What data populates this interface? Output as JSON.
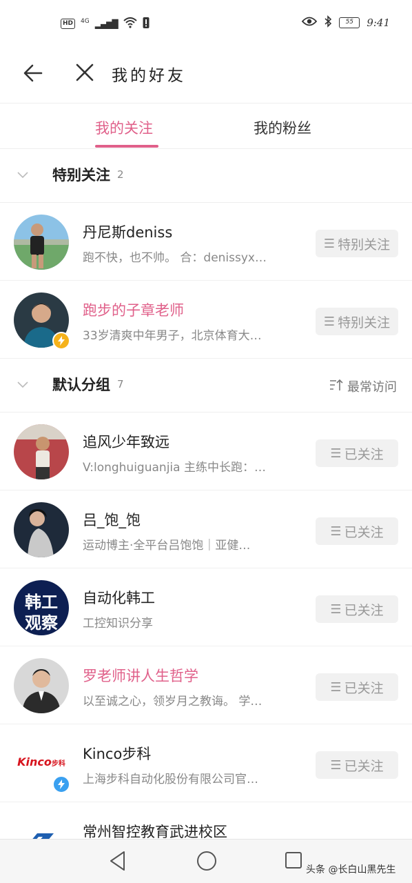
{
  "status_bar": {
    "hd": "HD",
    "network": "4G",
    "battery": "55",
    "time": "9:41"
  },
  "nav": {
    "title": "我的好友"
  },
  "tabs": [
    {
      "label": "我的关注",
      "active": true
    },
    {
      "label": "我的粉丝",
      "active": false
    }
  ],
  "groups": [
    {
      "name": "特别关注",
      "count": "2",
      "items": [
        {
          "name": "丹尼斯deniss",
          "desc": "跑不快，也不帅。 合：denissyx…",
          "button": "特别关注",
          "name_color": "#222222"
        },
        {
          "name": "跑步的子章老师",
          "desc": "33岁清爽中年男子，北京体育大…",
          "button": "特别关注",
          "name_color": "#e0608a",
          "badge": "lightning",
          "badge_color": "#f5b21b"
        }
      ]
    },
    {
      "name": "默认分组",
      "count": "7",
      "sort_label": "最常访问",
      "items": [
        {
          "name": "追风少年致远",
          "desc": "V:longhuiguanjia 主练中长跑：…",
          "button": "已关注",
          "name_color": "#222222"
        },
        {
          "name": "吕_饱_饱",
          "desc": "运动博主·全平台吕饱饱｜亚健…",
          "button": "已关注",
          "name_color": "#222222"
        },
        {
          "name": "自动化韩工",
          "desc": "工控知识分享",
          "button": "已关注",
          "name_color": "#222222",
          "avatar_text": [
            "韩工",
            "观察"
          ]
        },
        {
          "name": "罗老师讲人生哲学",
          "desc": "以至诚之心，领岁月之教诲。 学…",
          "button": "已关注",
          "name_color": "#e0608a"
        },
        {
          "name": "Kinco步科",
          "desc": "上海步科自动化股份有限公司官…",
          "button": "已关注",
          "name_color": "#222222",
          "avatar_text": [
            "Kinco",
            "步科"
          ],
          "badge": "lightning",
          "badge_color": "#3aa0f0"
        },
        {
          "name": "常州智控教育武进校区",
          "desc": "",
          "button": "",
          "name_color": "#222222"
        }
      ]
    }
  ],
  "watermark": "头条 @长白山黑先生",
  "colors": {
    "accent": "#e0608a",
    "button_bg": "#f1f1f1",
    "button_text": "#999999"
  }
}
